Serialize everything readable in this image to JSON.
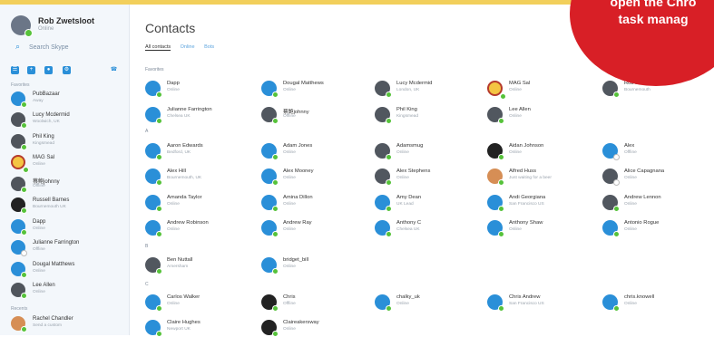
{
  "colors": {
    "accent": "#2a8fd8",
    "online": "#56c23a",
    "overlay": "#d81f26",
    "top_strip": "#f2cf5b"
  },
  "overlay": {
    "lines": [
      "open the Chro",
      "task manag"
    ]
  },
  "sidebar": {
    "user": {
      "name": "Rob Zwetsloot",
      "status": "Online"
    },
    "search": {
      "placeholder": "Search Skype"
    },
    "icons": [
      "contacts-icon",
      "add-contact-icon",
      "messages-icon",
      "settings-icon",
      "phone-icon"
    ],
    "sections": {
      "favorites": "Favorites",
      "recent": "Recents"
    },
    "items": [
      {
        "name": "PubBazaar",
        "status": "Away",
        "avatar": "blue"
      },
      {
        "name": "Lucy Mcdermid",
        "status": "Woolwich, UK",
        "avatar": "photo"
      },
      {
        "name": "Phil King",
        "status": "Kingsmead",
        "avatar": "photo"
      },
      {
        "name": "MAG Sal",
        "status": "Online",
        "avatar": "yellow"
      },
      {
        "name": "蔡鲍johnny",
        "status": "Offline",
        "avatar": "photo"
      },
      {
        "name": "Russell Barnes",
        "status": "Bournemouth UK",
        "avatar": "dark"
      },
      {
        "name": "Dapp",
        "status": "Online",
        "avatar": "blue"
      },
      {
        "name": "Julianne Farrington",
        "status": "Offline",
        "avatar": "blue"
      },
      {
        "name": "Dougal Matthews",
        "status": "Online",
        "avatar": "blue"
      },
      {
        "name": "Lee Allen",
        "status": "Online",
        "avatar": "photo"
      }
    ],
    "recent": [
      {
        "name": "Rachel Chandler",
        "status": "Send a custom",
        "avatar": "warm"
      }
    ]
  },
  "main": {
    "title": "Contacts",
    "tabs": [
      "All contacts",
      "Online",
      "Bots"
    ],
    "sections": [
      "Favorites",
      "A",
      "B",
      "C"
    ],
    "favorites": [
      {
        "name": "Dapp",
        "status": "Online",
        "avatar": "blue"
      },
      {
        "name": "Dougal Matthews",
        "status": "Online",
        "avatar": "blue"
      },
      {
        "name": "Lucy Mcdermid",
        "status": "London, UK",
        "avatar": "photo"
      },
      {
        "name": "MAG Sal",
        "status": "Online",
        "avatar": "yellow"
      },
      {
        "name": "Rob Zwetsloot",
        "status": "Bournemouth",
        "avatar": "photo"
      },
      {
        "name": "Julianne Farrington",
        "status": "Chelsea UK",
        "avatar": "blue"
      },
      {
        "name": "蔡鲍johnny",
        "status": "Offline",
        "avatar": "photo"
      },
      {
        "name": "Phil King",
        "status": "Kingsmead",
        "avatar": "photo"
      },
      {
        "name": "Lee Allen",
        "status": "Online",
        "avatar": "photo"
      }
    ],
    "a_contacts": [
      {
        "name": "Aaron Edwards",
        "status": "Bedford, UK",
        "avatar": "blue"
      },
      {
        "name": "Adam Jones",
        "status": "Online",
        "avatar": "blue"
      },
      {
        "name": "Adamsmug",
        "status": "Online",
        "avatar": "photo"
      },
      {
        "name": "Aidan Johnson",
        "status": "Online",
        "avatar": "dark"
      },
      {
        "name": "Alex",
        "status": "Offline",
        "avatar": "blue"
      },
      {
        "name": "Alex Hill",
        "status": "Bournemouth, UK",
        "avatar": "blue"
      },
      {
        "name": "Alex Mooney",
        "status": "Online",
        "avatar": "blue"
      },
      {
        "name": "Alex Stephens",
        "status": "Online",
        "avatar": "photo"
      },
      {
        "name": "Alfred Huss",
        "status": "Just waiting for a beer",
        "avatar": "warm"
      },
      {
        "name": "Alice Capagnana",
        "status": "Online",
        "avatar": "photo"
      },
      {
        "name": "Amanda Taylor",
        "status": "Online",
        "avatar": "blue"
      },
      {
        "name": "Amina Dillon",
        "status": "Online",
        "avatar": "blue"
      },
      {
        "name": "Amy Dean",
        "status": "UK Lead",
        "avatar": "blue"
      },
      {
        "name": "Andi Georgiana",
        "status": "San Francisco US",
        "avatar": "blue"
      },
      {
        "name": "Andrew Lennon",
        "status": "Online",
        "avatar": "photo"
      },
      {
        "name": "Andrew Robinson",
        "status": "Online",
        "avatar": "blue"
      },
      {
        "name": "Andrew Ray",
        "status": "Online",
        "avatar": "blue"
      },
      {
        "name": "Anthony C",
        "status": "Chelsea UK",
        "avatar": "blue"
      },
      {
        "name": "Anthony Shaw",
        "status": "Online",
        "avatar": "blue"
      },
      {
        "name": "Antonio Rogue",
        "status": "Online",
        "avatar": "blue"
      }
    ],
    "b_contacts": [
      {
        "name": "Ben Nuttall",
        "status": "Amersham",
        "avatar": "photo"
      },
      {
        "name": "bridget_bill",
        "status": "Online",
        "avatar": "blue"
      }
    ],
    "c_contacts": [
      {
        "name": "Carlos Walker",
        "status": "Online",
        "avatar": "blue"
      },
      {
        "name": "Chris",
        "status": "Offline",
        "avatar": "dark"
      },
      {
        "name": "chalky_uk",
        "status": "Online",
        "avatar": "blue"
      },
      {
        "name": "Chris Andrew",
        "status": "San Francisco US",
        "avatar": "blue"
      },
      {
        "name": "chris.knowell",
        "status": "Online",
        "avatar": "blue"
      },
      {
        "name": "Claire Hughes",
        "status": "Newport UK",
        "avatar": "blue"
      },
      {
        "name": "Claireakersway",
        "status": "Online",
        "avatar": "dark"
      }
    ]
  }
}
